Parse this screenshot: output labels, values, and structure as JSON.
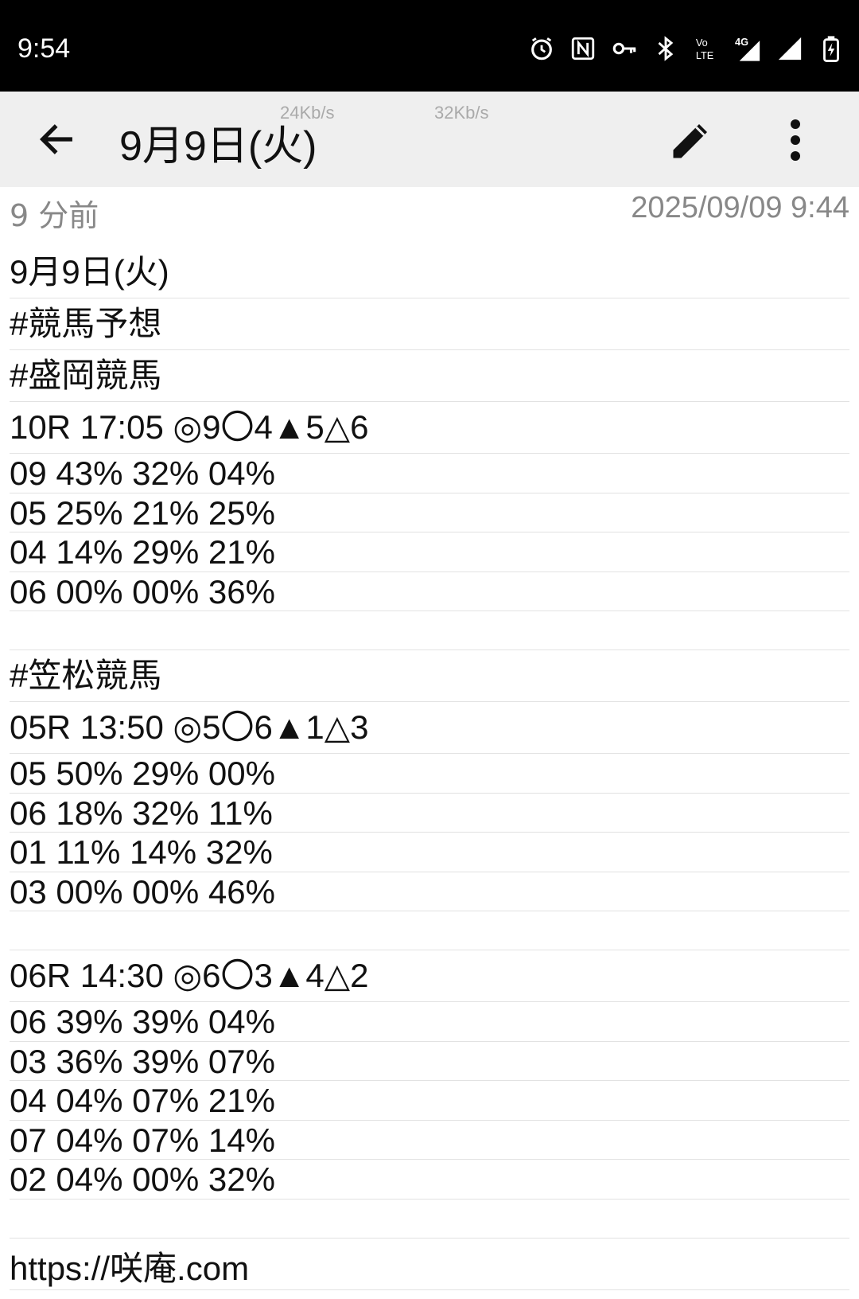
{
  "status_bar": {
    "time": "9:54",
    "icons": [
      "alarm-icon",
      "nfc-icon",
      "vpn-key-icon",
      "bluetooth-icon",
      "volte-icon",
      "signal-4g-icon",
      "signal-icon",
      "battery-charging-icon"
    ],
    "volte_label": "Vo LTE",
    "network": "4G"
  },
  "toolbar": {
    "title": "9月9日(火)",
    "speed_left": "24Kb/s",
    "speed_right": "32Kb/s"
  },
  "meta": {
    "relative_time": "9 分前",
    "timestamp": "2025/09/09 9:44"
  },
  "note": {
    "lines": [
      "9月9日(火)",
      "#競馬予想",
      "#盛岡競馬",
      "10R 17:05 ◎9〇4▲5△6",
      "09 43% 32% 04%",
      "05 25% 21% 25%",
      "04 14% 29% 21%",
      "06 00% 00% 36%",
      "",
      "#笠松競馬",
      "05R 13:50 ◎5〇6▲1△3",
      "05 50% 29% 00%",
      "06 18% 32% 11%",
      "01 11% 14% 32%",
      "03 00% 00% 46%",
      "",
      "06R 14:30 ◎6〇3▲4△2",
      "06 39% 39% 04%",
      "03 36% 39% 07%",
      "04 04% 07% 21%",
      "07 04% 07% 14%",
      "02 04% 00% 32%",
      "",
      "https://咲庵.com"
    ]
  }
}
